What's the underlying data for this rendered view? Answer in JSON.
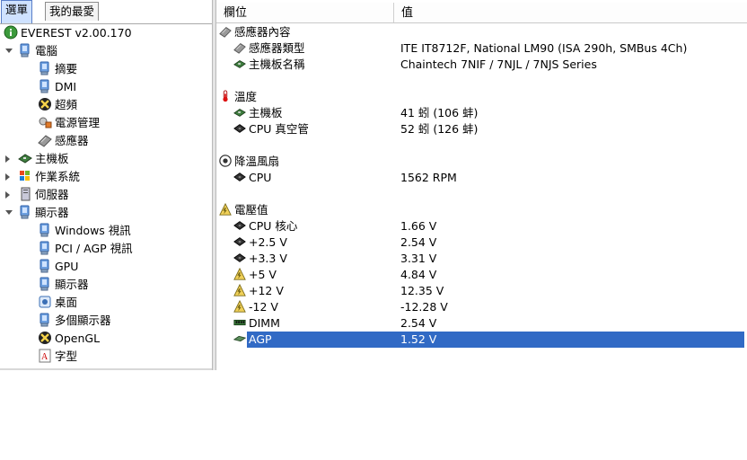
{
  "tabs": [
    {
      "label": "選單",
      "active": true
    },
    {
      "label": "我的最愛",
      "active": false
    }
  ],
  "tree": [
    {
      "label": "EVEREST v2.00.170",
      "icon": "info-icon",
      "level": 0,
      "expander": "none"
    },
    {
      "label": "電腦",
      "icon": "computer-icon",
      "level": 0,
      "expander": "open"
    },
    {
      "label": "摘要",
      "icon": "computer-icon",
      "level": 1,
      "expander": "none"
    },
    {
      "label": "DMI",
      "icon": "computer-icon",
      "level": 1,
      "expander": "none"
    },
    {
      "label": "超頻",
      "icon": "xbox-icon",
      "level": 1,
      "expander": "none"
    },
    {
      "label": "電源管理",
      "icon": "power-icon",
      "level": 1,
      "expander": "none"
    },
    {
      "label": "感應器",
      "icon": "sensor-icon",
      "level": 1,
      "expander": "none"
    },
    {
      "label": "主機板",
      "icon": "motherboard-icon",
      "level": 0,
      "expander": "closed"
    },
    {
      "label": "作業系統",
      "icon": "windows-icon",
      "level": 0,
      "expander": "closed"
    },
    {
      "label": "伺服器",
      "icon": "server-icon",
      "level": 0,
      "expander": "closed"
    },
    {
      "label": "顯示器",
      "icon": "computer-icon",
      "level": 0,
      "expander": "open"
    },
    {
      "label": "Windows 視訊",
      "icon": "computer-icon",
      "level": 1,
      "expander": "none"
    },
    {
      "label": "PCI / AGP 視訊",
      "icon": "computer-icon",
      "level": 1,
      "expander": "none"
    },
    {
      "label": "GPU",
      "icon": "computer-icon",
      "level": 1,
      "expander": "none"
    },
    {
      "label": "顯示器",
      "icon": "computer-icon",
      "level": 1,
      "expander": "none"
    },
    {
      "label": "桌面",
      "icon": "desktop-icon",
      "level": 1,
      "expander": "none"
    },
    {
      "label": "多個顯示器",
      "icon": "computer-icon",
      "level": 1,
      "expander": "none"
    },
    {
      "label": "OpenGL",
      "icon": "xbox-icon",
      "level": 1,
      "expander": "none"
    },
    {
      "label": "字型",
      "icon": "font-icon",
      "level": 1,
      "expander": "none"
    }
  ],
  "columns": {
    "field": "欄位",
    "value": "值"
  },
  "rows": [
    {
      "type": "group",
      "label": "感應器內容",
      "icon": "sensor-icon"
    },
    {
      "type": "item",
      "label": "感應器類型",
      "value": "ITE IT8712F, National LM90  (ISA 290h, SMBus 4Ch)",
      "icon": "sensor-icon"
    },
    {
      "type": "item",
      "label": "主機板名稱",
      "value": "Chaintech 7NIF / 7NJL / 7NJS Series",
      "icon": "motherboard-icon"
    },
    {
      "type": "spacer"
    },
    {
      "type": "group",
      "label": "溫度",
      "icon": "thermometer-icon"
    },
    {
      "type": "item",
      "label": "主機板",
      "value": "41 蚓  (106 蚌)",
      "icon": "motherboard-icon"
    },
    {
      "type": "item",
      "label": "CPU 真空管",
      "value": "52 蚓  (126 蚌)",
      "icon": "chip-icon"
    },
    {
      "type": "spacer"
    },
    {
      "type": "group",
      "label": "降溫風扇",
      "icon": "fan-icon"
    },
    {
      "type": "item",
      "label": "CPU",
      "value": "1562 RPM",
      "icon": "chip-icon"
    },
    {
      "type": "spacer"
    },
    {
      "type": "group",
      "label": "電壓值",
      "icon": "voltage-icon"
    },
    {
      "type": "item",
      "label": "CPU 核心",
      "value": "1.66 V",
      "icon": "chip-icon"
    },
    {
      "type": "item",
      "label": "+2.5 V",
      "value": "2.54 V",
      "icon": "chip-icon"
    },
    {
      "type": "item",
      "label": "+3.3 V",
      "value": "3.31 V",
      "icon": "chip-icon"
    },
    {
      "type": "item",
      "label": "+5 V",
      "value": "4.84 V",
      "icon": "voltage-icon"
    },
    {
      "type": "item",
      "label": "+12 V",
      "value": "12.35 V",
      "icon": "voltage-icon"
    },
    {
      "type": "item",
      "label": "-12 V",
      "value": "-12.28 V",
      "icon": "voltage-icon"
    },
    {
      "type": "item",
      "label": "DIMM",
      "value": "2.54 V",
      "icon": "dimm-icon"
    },
    {
      "type": "item",
      "label": "AGP",
      "value": "1.52 V",
      "icon": "agp-icon",
      "selected": true
    }
  ],
  "colors": {
    "selection": "#316ac5",
    "active_tab": "#cfe2ff"
  }
}
